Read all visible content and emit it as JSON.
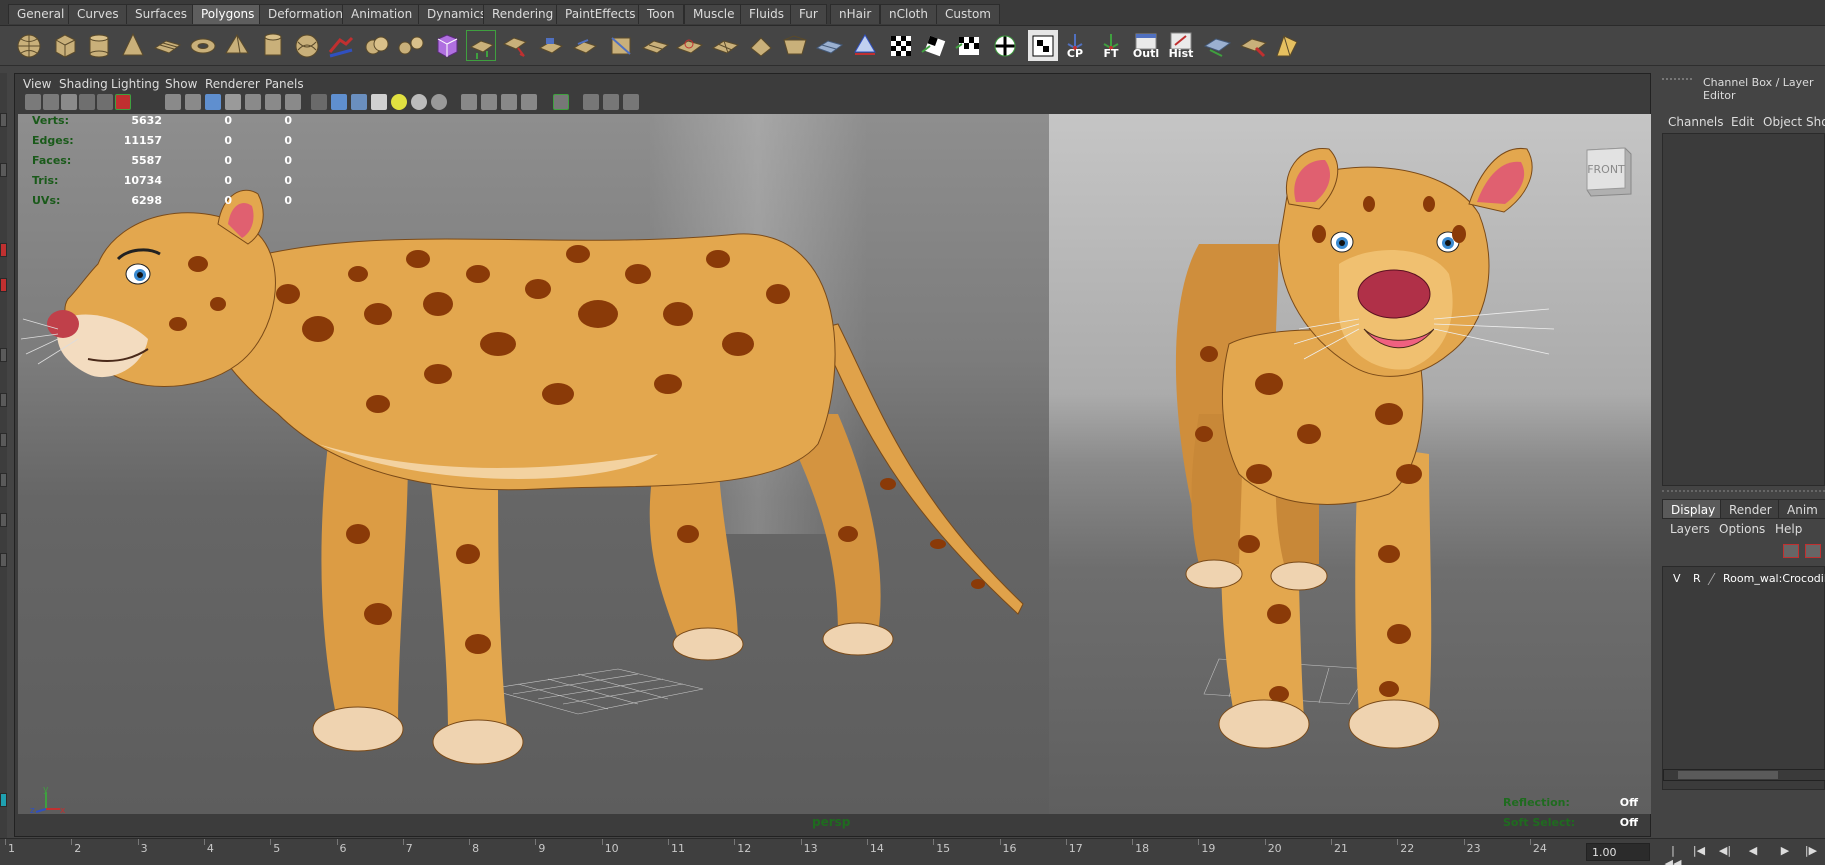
{
  "shelf_tabs": [
    "General",
    "Curves",
    "Surfaces",
    "Polygons",
    "Deformation",
    "Animation",
    "Dynamics",
    "Rendering",
    "PaintEffects",
    "Toon",
    "Muscle",
    "Fluids",
    "Fur",
    "nHair",
    "nCloth",
    "Custom"
  ],
  "active_tab": "Polygons",
  "shelf_text_buttons": {
    "cp": "CP",
    "ft": "FT",
    "outl": "Outl",
    "hist": "Hist"
  },
  "panel_menu": {
    "view": "View",
    "shading": "Shading",
    "lighting": "Lighting",
    "show": "Show",
    "renderer": "Renderer",
    "panels": "Panels"
  },
  "hud": {
    "rows": [
      {
        "label": "Verts:",
        "v1": "5632",
        "v2": "0",
        "v3": "0"
      },
      {
        "label": "Edges:",
        "v1": "11157",
        "v2": "0",
        "v3": "0"
      },
      {
        "label": "Faces:",
        "v1": "5587",
        "v2": "0",
        "v3": "0"
      },
      {
        "label": "Tris:",
        "v1": "10734",
        "v2": "0",
        "v3": "0"
      },
      {
        "label": "UVs:",
        "v1": "6298",
        "v2": "0",
        "v3": "0"
      }
    ],
    "camera": "persp",
    "reflection_label": "Reflection:",
    "reflection_value": "Off",
    "soft_select_label": "Soft Select:",
    "soft_select_value": "Off"
  },
  "viewcube_label": "FRONT",
  "axis": {
    "y": "y",
    "z": "z",
    "x": "x"
  },
  "channel_box": {
    "title": "Channel Box / Layer Editor",
    "menu": {
      "channels": "Channels",
      "edit": "Edit",
      "object": "Object",
      "show": "Sho"
    }
  },
  "layer_editor": {
    "tabs": {
      "display": "Display",
      "render": "Render",
      "anim": "Anim"
    },
    "menu": {
      "layers": "Layers",
      "options": "Options",
      "help": "Help"
    },
    "layer": {
      "v": "V",
      "r": "R",
      "name": "Room_wal:Crocodil"
    }
  },
  "timeline": {
    "frames": [
      "1",
      "2",
      "3",
      "4",
      "5",
      "6",
      "7",
      "8",
      "9",
      "10",
      "11",
      "12",
      "13",
      "14",
      "15",
      "16",
      "17",
      "18",
      "19",
      "20",
      "21",
      "22",
      "23",
      "24"
    ],
    "current_time": "1.00"
  },
  "colors": {
    "ui_bg": "#444444",
    "hud_label": "#1a5a1a",
    "leopard_body": "#e0a24a",
    "leopard_spot": "#8a3a08"
  }
}
